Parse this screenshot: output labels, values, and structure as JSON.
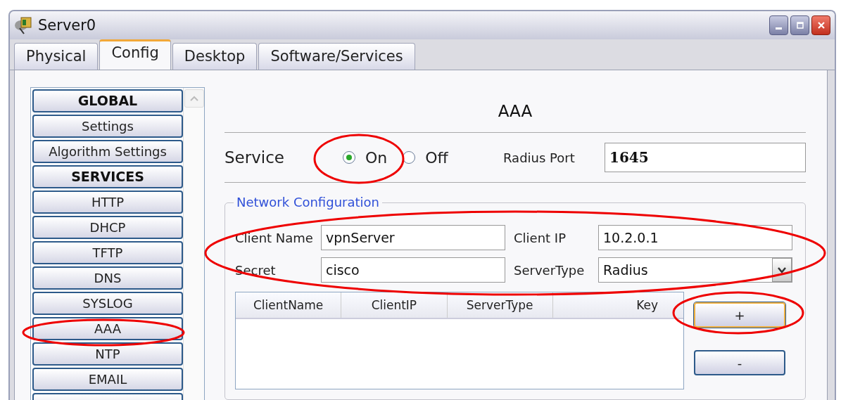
{
  "window": {
    "title": "Server0"
  },
  "tabs": [
    {
      "label": "Physical",
      "selected": false
    },
    {
      "label": "Config",
      "selected": true
    },
    {
      "label": "Desktop",
      "selected": false
    },
    {
      "label": "Software/Services",
      "selected": false
    }
  ],
  "sidebar": {
    "items": [
      {
        "kind": "header",
        "label": "GLOBAL"
      },
      {
        "kind": "item",
        "label": "Settings"
      },
      {
        "kind": "item",
        "label": "Algorithm Settings"
      },
      {
        "kind": "header",
        "label": "SERVICES"
      },
      {
        "kind": "item",
        "label": "HTTP"
      },
      {
        "kind": "item",
        "label": "DHCP"
      },
      {
        "kind": "item",
        "label": "TFTP"
      },
      {
        "kind": "item",
        "label": "DNS"
      },
      {
        "kind": "item",
        "label": "SYSLOG"
      },
      {
        "kind": "item",
        "label": "AAA"
      },
      {
        "kind": "item",
        "label": "NTP"
      },
      {
        "kind": "item",
        "label": "EMAIL"
      }
    ]
  },
  "panel": {
    "title": "AAA",
    "service": {
      "label": "Service",
      "options": [
        {
          "label": "On",
          "selected": true
        },
        {
          "label": "Off",
          "selected": false
        }
      ]
    },
    "radius_port": {
      "label": "Radius Port",
      "value": "1645"
    },
    "network_configuration": {
      "title": "Network Configuration",
      "client_name": {
        "label": "Client Name",
        "value": "vpnServer"
      },
      "client_ip": {
        "label": "Client IP",
        "value": "10.2.0.1"
      },
      "secret": {
        "label": "Secret",
        "value": "cisco"
      },
      "server_type": {
        "label": "ServerType",
        "value": "Radius"
      },
      "table": {
        "columns": [
          "ClientName",
          "ClientIP",
          "ServerType",
          "Key"
        ]
      },
      "buttons": [
        "+",
        "-"
      ]
    }
  }
}
